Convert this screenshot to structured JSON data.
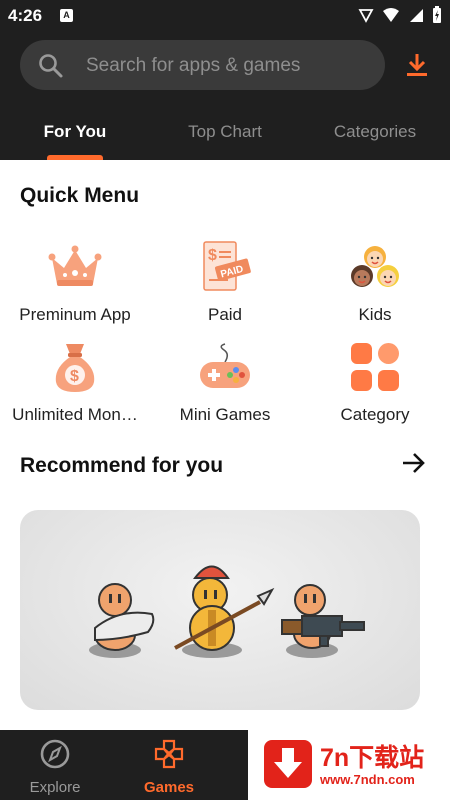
{
  "status_bar": {
    "time": "4:26",
    "notification_badge": "A"
  },
  "search": {
    "placeholder": "Search for apps & games"
  },
  "tabs": [
    {
      "label": "For You",
      "active": true
    },
    {
      "label": "Top Chart",
      "active": false
    },
    {
      "label": "Categories",
      "active": false
    }
  ],
  "quick_menu": {
    "title": "Quick Menu",
    "items": [
      {
        "label": "Preminum App",
        "icon": "crown-icon"
      },
      {
        "label": "Paid",
        "icon": "paid-receipt-icon"
      },
      {
        "label": "Kids",
        "icon": "kids-faces-icon"
      },
      {
        "label": "Unlimited Mon…",
        "icon": "money-bag-icon"
      },
      {
        "label": "Mini Games",
        "icon": "gamepad-icon"
      },
      {
        "label": "Category",
        "icon": "grid-icon"
      }
    ]
  },
  "recommend": {
    "title": "Recommend for you"
  },
  "bottom_nav": {
    "items": [
      {
        "label": "Explore",
        "icon": "compass-icon",
        "active": false
      },
      {
        "label": "Games",
        "icon": "gamepad-cross-icon",
        "active": true
      }
    ]
  },
  "watermark": {
    "title": "7n下载站",
    "url": "www.7ndn.com"
  },
  "colors": {
    "accent": "#ff6a2c",
    "header_bg": "#1f1f1f",
    "search_bg": "#3a3a3a",
    "watermark_red": "#e2231a"
  }
}
